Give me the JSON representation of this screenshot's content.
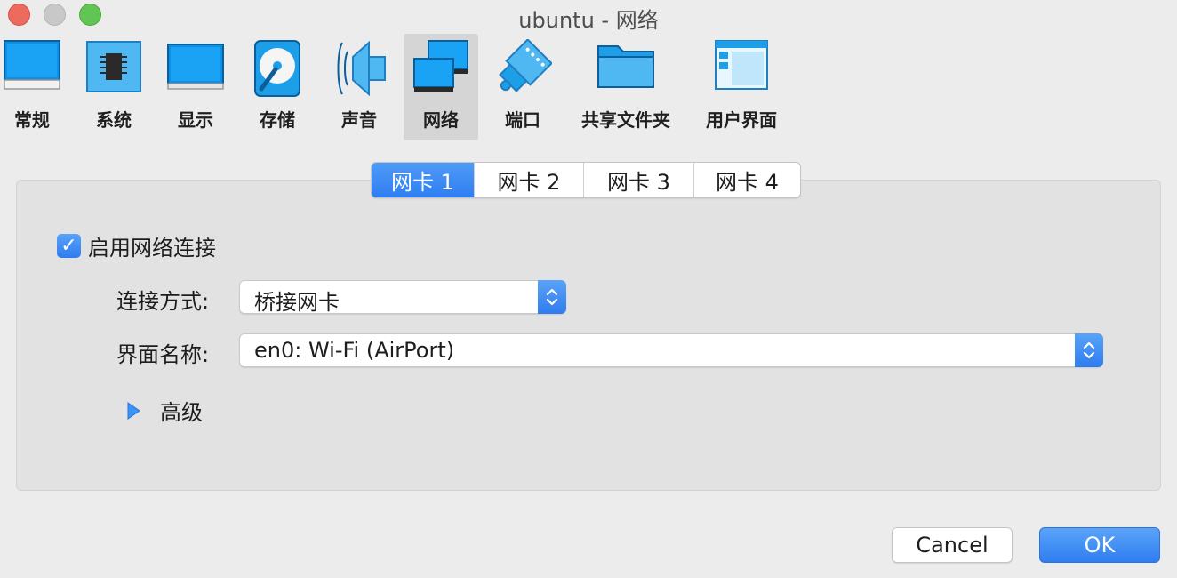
{
  "window": {
    "title": "ubuntu - 网络"
  },
  "toolbar": {
    "items": [
      {
        "label": "常规",
        "icon": "monitor-general-icon"
      },
      {
        "label": "系统",
        "icon": "chip-icon"
      },
      {
        "label": "显示",
        "icon": "display-icon"
      },
      {
        "label": "存储",
        "icon": "disk-icon"
      },
      {
        "label": "声音",
        "icon": "speaker-icon"
      },
      {
        "label": "网络",
        "icon": "network-icon",
        "active": true
      },
      {
        "label": "端口",
        "icon": "serial-port-icon"
      },
      {
        "label": "共享文件夹",
        "icon": "folder-icon"
      },
      {
        "label": "用户界面",
        "icon": "window-icon"
      }
    ]
  },
  "tabs": [
    {
      "label": "网卡 1",
      "active": true
    },
    {
      "label": "网卡 2"
    },
    {
      "label": "网卡 3"
    },
    {
      "label": "网卡 4"
    }
  ],
  "adapter": {
    "enable_label": "启用网络连接",
    "enabled": true,
    "attached_label": "连接方式:",
    "attached_value": "桥接网卡",
    "name_label": "界面名称:",
    "name_value": "en0: Wi-Fi (AirPort)",
    "advanced_label": "高级"
  },
  "buttons": {
    "cancel": "Cancel",
    "ok": "OK"
  },
  "colors": {
    "accent": "#2f7ef1",
    "panel": "#e2e2e2",
    "window": "#ececec"
  }
}
